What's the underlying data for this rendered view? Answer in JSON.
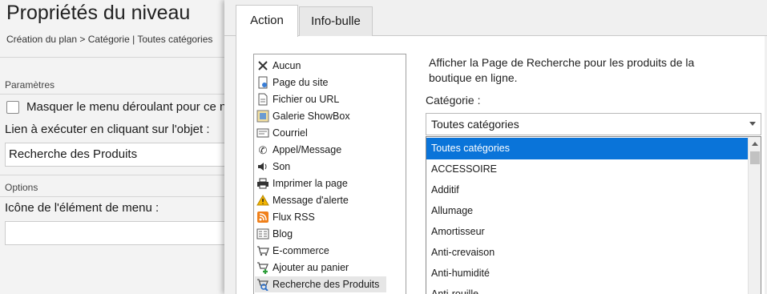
{
  "page": {
    "title": "Propriétés du niveau",
    "breadcrumb": "Création du plan > Catégorie | Toutes catégories"
  },
  "left_panel": {
    "params_label": "Paramètres",
    "hide_menu_label": "Masquer le menu déroulant pour ce n",
    "hide_menu_checked": false,
    "link_label": "Lien à exécuter en cliquant sur l'objet :",
    "link_value": "Recherche des Produits",
    "options_label": "Options",
    "icon_label": "Icône de l'élément de menu :",
    "icon_value": ""
  },
  "dialog": {
    "tabs": [
      {
        "label": "Action",
        "active": true
      },
      {
        "label": "Info-bulle",
        "active": false
      }
    ],
    "actions": [
      {
        "label": "Aucun",
        "icon": "cross-icon"
      },
      {
        "label": "Page du site",
        "icon": "page-icon"
      },
      {
        "label": "Fichier ou URL",
        "icon": "file-icon"
      },
      {
        "label": "Galerie ShowBox",
        "icon": "gallery-icon"
      },
      {
        "label": "Courriel",
        "icon": "email-icon"
      },
      {
        "label": "Appel/Message",
        "icon": "phone-icon"
      },
      {
        "label": "Son",
        "icon": "speaker-icon"
      },
      {
        "label": "Imprimer la page",
        "icon": "printer-icon"
      },
      {
        "label": "Message d'alerte",
        "icon": "warning-icon"
      },
      {
        "label": "Flux RSS",
        "icon": "rss-icon"
      },
      {
        "label": "Blog",
        "icon": "blog-icon"
      },
      {
        "label": "E-commerce",
        "icon": "cart-icon"
      },
      {
        "label": "Ajouter au panier",
        "icon": "cart-add-icon"
      },
      {
        "label": "Recherche des Produits",
        "icon": "cart-search-icon"
      }
    ],
    "selected_action": "Recherche des Produits",
    "description": "Afficher la Page de Recherche pour les produits de la boutique en ligne.",
    "category_label": "Catégorie :",
    "category_value": "Toutes catégories",
    "category_options": [
      "Toutes catégories",
      "ACCESSOIRE",
      "Additif",
      "Allumage",
      "Amortisseur",
      "Anti-crevaison",
      "Anti-humidité",
      "Anti-rouille"
    ],
    "colors": {
      "selection": "#0a74d9",
      "rss": "#f0801a",
      "warning": "#f2b400",
      "cart_add": "#2e9e3a"
    }
  }
}
